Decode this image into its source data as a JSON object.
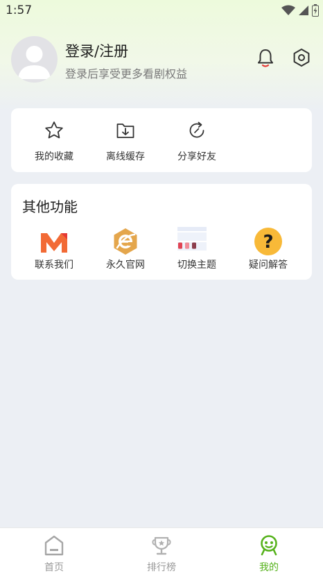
{
  "status_bar": {
    "time": "1:57"
  },
  "profile": {
    "title": "登录/注册",
    "subtitle": "登录后享受更多看剧权益"
  },
  "quick_actions": [
    {
      "label": "我的收藏",
      "icon": "star-icon"
    },
    {
      "label": "离线缓存",
      "icon": "download-folder-icon"
    },
    {
      "label": "分享好友",
      "icon": "share-refresh-icon"
    }
  ],
  "other_functions": {
    "title": "其他功能",
    "items": [
      {
        "label": "联系我们",
        "icon": "gmail-m-icon"
      },
      {
        "label": "永久官网",
        "icon": "browser-e-icon"
      },
      {
        "label": "切换主题",
        "icon": "theme-palette-icon"
      },
      {
        "label": "疑问解答",
        "icon": "question-icon"
      }
    ]
  },
  "tabbar": [
    {
      "label": "首页",
      "icon": "home-icon",
      "active": false
    },
    {
      "label": "排行榜",
      "icon": "trophy-icon",
      "active": false
    },
    {
      "label": "我的",
      "icon": "mine-icon",
      "active": true
    }
  ],
  "colors": {
    "accent": "#56b21c",
    "inactive": "#9a9a9a",
    "background": "#eceff4",
    "header_tint": "#edfadc"
  }
}
